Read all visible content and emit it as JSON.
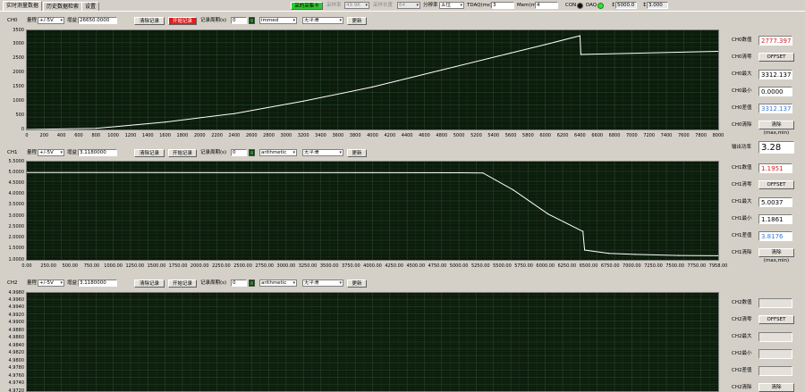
{
  "tabs": [
    "实时测量数据",
    "历史数据检索",
    "设置"
  ],
  "toolbar": {
    "acq_button": "采的采集卡",
    "sample_rate_label": "采样率",
    "sample_rate_value": "49.9K",
    "sample_len_label": "采样长度",
    "sample_len_value": "64",
    "resolution_label": "分辨率",
    "resolution_value": "五位",
    "tdaq_label": "TDAQ(ms)",
    "tdaq_value": "3",
    "mem_label": "Mem(ms)",
    "mem_value": "4",
    "con_label": "CON",
    "daq_label": "DAQ",
    "counter1": "5000.0",
    "counter2": "3.000"
  },
  "power": {
    "label": "输出功率",
    "value": "3.28"
  },
  "channels": [
    {
      "name": "CH0",
      "range_label": "量程",
      "range": "+/-5V",
      "gain_label": "增益",
      "gain": "26650.0000",
      "clear_btn": "清除记录",
      "start_btn": "开始记录",
      "period_label": "记录周期(s)",
      "period": "0",
      "mode": "immed",
      "smooth": "无平滑",
      "update_btn": "更新",
      "side": [
        {
          "label": "CH0数值",
          "value": "2777.3972",
          "color": "#d02020"
        },
        {
          "label": "CH0清零",
          "button": "OFFSET"
        },
        {
          "label": "CH0最大",
          "value": "3312.1376",
          "color": "#000000"
        },
        {
          "label": "CH0最小",
          "value": "0.0000",
          "color": "#000000"
        },
        {
          "label": "CH0差值",
          "value": "3312.1376",
          "color": "#3c7ad8"
        },
        {
          "label": "CH0清除",
          "button": "清除(max,min)"
        }
      ]
    },
    {
      "name": "CH1",
      "range_label": "量程",
      "range": "+/-5V",
      "gain_label": "增益",
      "gain": "3.1180000",
      "clear_btn": "清除记录",
      "start_btn": "开始记录",
      "period_label": "记录周期(s)",
      "period": "0",
      "mode": "arithmetic",
      "smooth": "无平滑",
      "update_btn": "更新",
      "side": [
        {
          "label": "CH1数值",
          "value": "1.1951",
          "color": "#d02020"
        },
        {
          "label": "CH1清零",
          "button": "OFFSET"
        },
        {
          "label": "CH1最大",
          "value": "5.0037",
          "color": "#000000"
        },
        {
          "label": "CH1最小",
          "value": "1.1861",
          "color": "#000000"
        },
        {
          "label": "CH1差值",
          "value": "3.8176",
          "color": "#3c7ad8"
        },
        {
          "label": "CH1清除",
          "button": "清除(max,min)"
        }
      ]
    },
    {
      "name": "CH2",
      "range_label": "量程",
      "range": "+/-5V",
      "gain_label": "增益",
      "gain": "3.1180000",
      "clear_btn": "清除记录",
      "start_btn": "开始记录",
      "period_label": "记录周期(s)",
      "period": "0",
      "mode": "arithmetic",
      "smooth": "无平滑",
      "update_btn": "更新",
      "side": [
        {
          "label": "CH2数值",
          "value": "",
          "color": "#000000"
        },
        {
          "label": "CH2清零",
          "button": "OFFSET"
        },
        {
          "label": "CH2最大",
          "value": "",
          "color": "#000000"
        },
        {
          "label": "CH2最小",
          "value": "",
          "color": "#000000"
        },
        {
          "label": "CH2差值",
          "value": "",
          "color": "#000000"
        },
        {
          "label": "CH2清除",
          "button": "清除(max,min)"
        }
      ]
    }
  ],
  "chart_data": [
    {
      "type": "line",
      "yticks": [
        "3500",
        "3000",
        "2500",
        "2000",
        "1500",
        "1000",
        "500",
        "0"
      ],
      "ylim": [
        0,
        3500
      ],
      "xticks": [
        "0",
        "200",
        "400",
        "600",
        "800",
        "1000",
        "1200",
        "1400",
        "1600",
        "1800",
        "2000",
        "2200",
        "2400",
        "2600",
        "2800",
        "3000",
        "3200",
        "3400",
        "3600",
        "3800",
        "4000",
        "4200",
        "4400",
        "4600",
        "4800",
        "5000",
        "5200",
        "5400",
        "5600",
        "5800",
        "6000",
        "6200",
        "6400",
        "6600",
        "6800",
        "7000",
        "7200",
        "7400",
        "7600",
        "7800",
        "8000"
      ],
      "xlim": [
        0,
        8000
      ],
      "series": [
        {
          "x": [
            0,
            800,
            1600,
            2400,
            3200,
            4000,
            4800,
            5600,
            6000,
            6400,
            6410,
            8000
          ],
          "y": [
            0,
            40,
            260,
            560,
            1000,
            1500,
            2100,
            2700,
            3000,
            3310,
            2650,
            2760
          ]
        }
      ],
      "grid": true
    },
    {
      "type": "line",
      "yticks": [
        "5.5000",
        "5.0000",
        "4.5000",
        "4.0000",
        "3.5000",
        "3.0000",
        "2.5000",
        "2.0000",
        "1.5000",
        "1.0000"
      ],
      "ylim": [
        1.0,
        5.5
      ],
      "xticks": [
        "0.00",
        "250.00",
        "500.00",
        "750.00",
        "1000.00",
        "1250.00",
        "1500.00",
        "1750.00",
        "2000.00",
        "2250.00",
        "2500.00",
        "2750.00",
        "3000.00",
        "3250.00",
        "3500.00",
        "3750.00",
        "4000.00",
        "4250.00",
        "4500.00",
        "4750.00",
        "5000.00",
        "5250.00",
        "5500.00",
        "5750.00",
        "6000.00",
        "6250.00",
        "6500.00",
        "6750.00",
        "7000.00",
        "7250.00",
        "7500.00",
        "7750.00",
        "7958.00"
      ],
      "xlim": [
        0,
        7958
      ],
      "series": [
        {
          "x": [
            0,
            5000,
            5250,
            5600,
            6000,
            6400,
            6420,
            6700,
            7000,
            7500,
            7958
          ],
          "y": [
            5.0,
            4.99,
            4.98,
            4.2,
            3.1,
            2.3,
            1.45,
            1.3,
            1.25,
            1.2,
            1.19
          ]
        }
      ],
      "grid": true
    },
    {
      "type": "line",
      "yticks": [
        "4.9980",
        "4.9960",
        "4.9940",
        "4.9920",
        "4.9900",
        "4.9880",
        "4.9860",
        "4.9840",
        "4.9820",
        "4.9800",
        "4.9780",
        "4.9760",
        "4.9740",
        "4.9720"
      ],
      "ylim": [
        4.9712,
        4.9985
      ],
      "series": [],
      "grid": true
    }
  ]
}
